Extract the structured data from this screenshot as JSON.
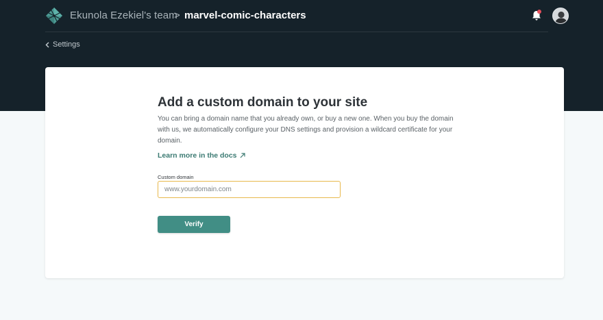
{
  "header": {
    "team_name": "Ekunola Ezekiel's team",
    "separator": ">",
    "site_name": "marvel-comic-characters",
    "logo_icon": "netlify-logo-icon",
    "notification_icon": "bell-icon",
    "accent_color": "#e6505c"
  },
  "nav": {
    "back_label": "Settings",
    "back_icon": "chevron-left-icon"
  },
  "card": {
    "title": "Add a custom domain to your site",
    "description": "You can bring a domain name that you already own, or buy a new one. When you buy the domain with us, we automatically configure your DNS settings and provision a wildcard certificate for your domain.",
    "docs_link": "Learn more in the docs",
    "docs_icon": "external-arrow-icon",
    "field_label": "Custom domain",
    "input_value": "",
    "input_placeholder": "www.yourdomain.com",
    "input_focus_color": "#e8b84b",
    "verify_label": "Verify",
    "button_color": "#418e85"
  }
}
